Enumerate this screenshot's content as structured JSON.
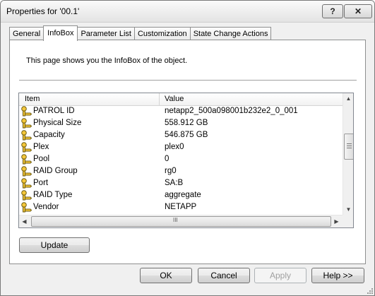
{
  "window": {
    "title": "Properties for '00.1'",
    "help_symbol": "?",
    "close_symbol": "✕"
  },
  "tabs": [
    {
      "label": "General"
    },
    {
      "label": "InfoBox"
    },
    {
      "label": "Parameter List"
    },
    {
      "label": "Customization"
    },
    {
      "label": "State Change Actions"
    }
  ],
  "panel": {
    "description": "This page shows you the InfoBox of the object."
  },
  "grid": {
    "columns": {
      "item": "Item",
      "value": "Value"
    },
    "rows": [
      {
        "item": "PATROL ID",
        "value": "netapp2_500a098001b232e2_0_001"
      },
      {
        "item": "Physical Size",
        "value": "558.912 GB"
      },
      {
        "item": "Capacity",
        "value": "546.875 GB"
      },
      {
        "item": "Plex",
        "value": "plex0"
      },
      {
        "item": "Pool",
        "value": "0"
      },
      {
        "item": "RAID Group",
        "value": "rg0"
      },
      {
        "item": "Port",
        "value": "SA:B"
      },
      {
        "item": "RAID Type",
        "value": "aggregate"
      },
      {
        "item": "Vendor",
        "value": "NETAPP"
      }
    ],
    "scroll_up": "▲",
    "scroll_down": "▼",
    "scroll_left": "◀",
    "scroll_right": "▶",
    "hscroll_grip": "III"
  },
  "buttons": {
    "update": "Update",
    "ok": "OK",
    "cancel": "Cancel",
    "apply": "Apply",
    "help": "Help >>"
  },
  "colors": {
    "row_icon_body": "#f4c73a",
    "row_icon_outline": "#6b5a10"
  }
}
